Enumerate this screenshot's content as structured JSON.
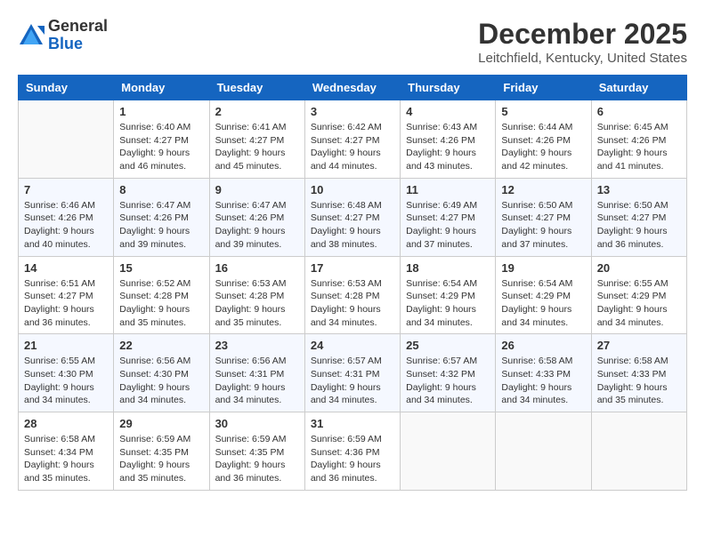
{
  "logo": {
    "general": "General",
    "blue": "Blue"
  },
  "title": "December 2025",
  "location": "Leitchfield, Kentucky, United States",
  "weekdays": [
    "Sunday",
    "Monday",
    "Tuesday",
    "Wednesday",
    "Thursday",
    "Friday",
    "Saturday"
  ],
  "weeks": [
    [
      {
        "day": "",
        "info": ""
      },
      {
        "day": "1",
        "info": "Sunrise: 6:40 AM\nSunset: 4:27 PM\nDaylight: 9 hours and 46 minutes."
      },
      {
        "day": "2",
        "info": "Sunrise: 6:41 AM\nSunset: 4:27 PM\nDaylight: 9 hours and 45 minutes."
      },
      {
        "day": "3",
        "info": "Sunrise: 6:42 AM\nSunset: 4:27 PM\nDaylight: 9 hours and 44 minutes."
      },
      {
        "day": "4",
        "info": "Sunrise: 6:43 AM\nSunset: 4:26 PM\nDaylight: 9 hours and 43 minutes."
      },
      {
        "day": "5",
        "info": "Sunrise: 6:44 AM\nSunset: 4:26 PM\nDaylight: 9 hours and 42 minutes."
      },
      {
        "day": "6",
        "info": "Sunrise: 6:45 AM\nSunset: 4:26 PM\nDaylight: 9 hours and 41 minutes."
      }
    ],
    [
      {
        "day": "7",
        "info": "Sunrise: 6:46 AM\nSunset: 4:26 PM\nDaylight: 9 hours and 40 minutes."
      },
      {
        "day": "8",
        "info": "Sunrise: 6:47 AM\nSunset: 4:26 PM\nDaylight: 9 hours and 39 minutes."
      },
      {
        "day": "9",
        "info": "Sunrise: 6:47 AM\nSunset: 4:26 PM\nDaylight: 9 hours and 39 minutes."
      },
      {
        "day": "10",
        "info": "Sunrise: 6:48 AM\nSunset: 4:27 PM\nDaylight: 9 hours and 38 minutes."
      },
      {
        "day": "11",
        "info": "Sunrise: 6:49 AM\nSunset: 4:27 PM\nDaylight: 9 hours and 37 minutes."
      },
      {
        "day": "12",
        "info": "Sunrise: 6:50 AM\nSunset: 4:27 PM\nDaylight: 9 hours and 37 minutes."
      },
      {
        "day": "13",
        "info": "Sunrise: 6:50 AM\nSunset: 4:27 PM\nDaylight: 9 hours and 36 minutes."
      }
    ],
    [
      {
        "day": "14",
        "info": "Sunrise: 6:51 AM\nSunset: 4:27 PM\nDaylight: 9 hours and 36 minutes."
      },
      {
        "day": "15",
        "info": "Sunrise: 6:52 AM\nSunset: 4:28 PM\nDaylight: 9 hours and 35 minutes."
      },
      {
        "day": "16",
        "info": "Sunrise: 6:53 AM\nSunset: 4:28 PM\nDaylight: 9 hours and 35 minutes."
      },
      {
        "day": "17",
        "info": "Sunrise: 6:53 AM\nSunset: 4:28 PM\nDaylight: 9 hours and 34 minutes."
      },
      {
        "day": "18",
        "info": "Sunrise: 6:54 AM\nSunset: 4:29 PM\nDaylight: 9 hours and 34 minutes."
      },
      {
        "day": "19",
        "info": "Sunrise: 6:54 AM\nSunset: 4:29 PM\nDaylight: 9 hours and 34 minutes."
      },
      {
        "day": "20",
        "info": "Sunrise: 6:55 AM\nSunset: 4:29 PM\nDaylight: 9 hours and 34 minutes."
      }
    ],
    [
      {
        "day": "21",
        "info": "Sunrise: 6:55 AM\nSunset: 4:30 PM\nDaylight: 9 hours and 34 minutes."
      },
      {
        "day": "22",
        "info": "Sunrise: 6:56 AM\nSunset: 4:30 PM\nDaylight: 9 hours and 34 minutes."
      },
      {
        "day": "23",
        "info": "Sunrise: 6:56 AM\nSunset: 4:31 PM\nDaylight: 9 hours and 34 minutes."
      },
      {
        "day": "24",
        "info": "Sunrise: 6:57 AM\nSunset: 4:31 PM\nDaylight: 9 hours and 34 minutes."
      },
      {
        "day": "25",
        "info": "Sunrise: 6:57 AM\nSunset: 4:32 PM\nDaylight: 9 hours and 34 minutes."
      },
      {
        "day": "26",
        "info": "Sunrise: 6:58 AM\nSunset: 4:33 PM\nDaylight: 9 hours and 34 minutes."
      },
      {
        "day": "27",
        "info": "Sunrise: 6:58 AM\nSunset: 4:33 PM\nDaylight: 9 hours and 35 minutes."
      }
    ],
    [
      {
        "day": "28",
        "info": "Sunrise: 6:58 AM\nSunset: 4:34 PM\nDaylight: 9 hours and 35 minutes."
      },
      {
        "day": "29",
        "info": "Sunrise: 6:59 AM\nSunset: 4:35 PM\nDaylight: 9 hours and 35 minutes."
      },
      {
        "day": "30",
        "info": "Sunrise: 6:59 AM\nSunset: 4:35 PM\nDaylight: 9 hours and 36 minutes."
      },
      {
        "day": "31",
        "info": "Sunrise: 6:59 AM\nSunset: 4:36 PM\nDaylight: 9 hours and 36 minutes."
      },
      {
        "day": "",
        "info": ""
      },
      {
        "day": "",
        "info": ""
      },
      {
        "day": "",
        "info": ""
      }
    ]
  ]
}
